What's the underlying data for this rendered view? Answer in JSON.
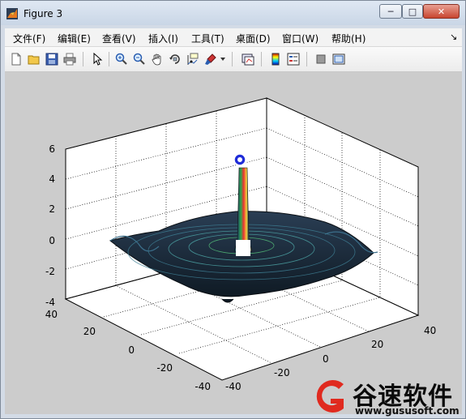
{
  "window": {
    "title": "Figure 3",
    "controls": {
      "minimize": "─",
      "maximize": "□",
      "close": "✕"
    }
  },
  "menu": {
    "items": [
      {
        "label": "文件(F)"
      },
      {
        "label": "编辑(E)"
      },
      {
        "label": "查看(V)"
      },
      {
        "label": "插入(I)"
      },
      {
        "label": "工具(T)"
      },
      {
        "label": "桌面(D)"
      },
      {
        "label": "窗口(W)"
      },
      {
        "label": "帮助(H)"
      }
    ],
    "dock_glyph": "↘"
  },
  "toolbar": {
    "buttons": [
      {
        "name": "new-figure-icon"
      },
      {
        "name": "open-file-icon"
      },
      {
        "name": "save-figure-icon"
      },
      {
        "name": "print-figure-icon"
      },
      {
        "name": "edit-plot-arrow-icon"
      },
      {
        "name": "zoom-in-icon"
      },
      {
        "name": "zoom-out-icon"
      },
      {
        "name": "pan-hand-icon"
      },
      {
        "name": "rotate-3d-icon"
      },
      {
        "name": "data-cursor-icon"
      },
      {
        "name": "brush-icon"
      },
      {
        "name": "link-plot-icon"
      },
      {
        "name": "insert-colorbar-icon"
      },
      {
        "name": "insert-legend-icon"
      },
      {
        "name": "hide-plot-tools-icon"
      },
      {
        "name": "show-plot-tools-icon"
      }
    ]
  },
  "plot": {
    "type": "surface-3d",
    "z_ticks": [
      "6",
      "4",
      "2",
      "0",
      "-2",
      "-4"
    ],
    "y_ticks": [
      "40",
      "20",
      "0",
      "-20",
      "-40"
    ],
    "x_ticks": [
      "-40",
      "-20",
      "0",
      "20",
      "40"
    ],
    "colors": {
      "background": "#cccccc",
      "surface_dark": "#1a2a3a",
      "accent_blue": "#0000ff"
    }
  },
  "brand": {
    "name": "谷速软件",
    "url": "www.gususoft.com",
    "color": "#e02a1f"
  }
}
